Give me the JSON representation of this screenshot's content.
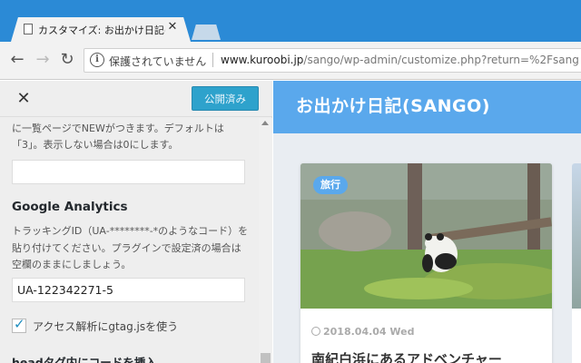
{
  "browser": {
    "tab_title": "カスタマイズ: お出かけ日記(S…",
    "secure_label": "保護されていません",
    "url_host": "www.kuroobi.jp",
    "url_path": "/sango/wp-admin/customize.php?return=%2Fsang"
  },
  "panel": {
    "publish_label": "公開済み",
    "desc_top": "に一覧ページでNEWがつきます。デフォルトは「3」。表示しない場合は0にします。",
    "ga_title": "Google Analytics",
    "ga_desc": "トラッキングID（UA-********-*のようなコード）を貼り付けてください。プラグインで設定済の場合は空欄のままにしましょう。",
    "ga_value": "UA-122342271-5",
    "checkbox_label": "アクセス解析にgtag.jsを使う",
    "next_title": "headタグ内にコードを挿入"
  },
  "preview": {
    "site_title": "お出かけ日記(SANGO)",
    "category": "旅行",
    "date": "2018.04.04 Wed",
    "post_title": "南紀白浜にあるアドベンチャー"
  },
  "colors": {
    "titlebar": "#2b8ad6",
    "publish": "#2ea2cc",
    "site_header": "#5aa8ec"
  }
}
